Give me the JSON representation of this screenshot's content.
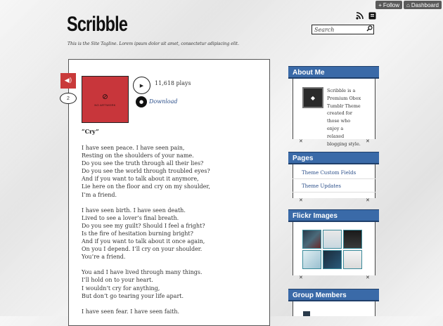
{
  "topbar": {
    "follow_label": "Follow",
    "dashboard_label": "Dashboard"
  },
  "site": {
    "title": "Scribble",
    "tagline": "This is the Site Tagline. Lorem ipsum dolor sit amet, consectetur adipiscing elit.",
    "search_placeholder": "Search"
  },
  "post": {
    "like_icon": "megaphone-icon",
    "notes_count": "2",
    "album_art_text": "NO ARTWORK",
    "plays": "11,618 plays",
    "download_label": "Download",
    "song_title": "“Cry”",
    "stanzas": [
      [
        "I have seen peace. I have seen pain,",
        "Resting on the shoulders of your name.",
        "Do you see the truth through all their lies?",
        "Do you see the world through troubled eyes?",
        "And if you want to talk about it anymore,",
        "Lie here on the floor and cry on my shoulder,",
        "I’m a friend."
      ],
      [
        "I have seen birth. I have seen death.",
        "Lived to see a lover’s final breath.",
        "Do you see my guilt? Should I feel a fright?",
        "Is the fire of hesitation burning bright?",
        "And if you want to talk about it once again,",
        "On you I depend. I’ll cry on your shoulder.",
        "You’re a friend."
      ],
      [
        "You and I have lived through many things.",
        "I’ll hold on to your heart.",
        "I wouldn’t cry for anything,",
        "But don’t go tearing your life apart."
      ],
      [
        "I have seen fear. I have seen faith."
      ]
    ]
  },
  "sidebar": {
    "about": {
      "title": "About Me",
      "text": "Scribble is a Premium Obox Tumblr Theme created for those who enjoy a relaxed blogging style."
    },
    "pages": {
      "title": "Pages",
      "items": [
        "Theme Custom Fields",
        "Theme Updates"
      ]
    },
    "flickr": {
      "title": "Flickr Images"
    },
    "members": {
      "title": "Group Members"
    }
  }
}
